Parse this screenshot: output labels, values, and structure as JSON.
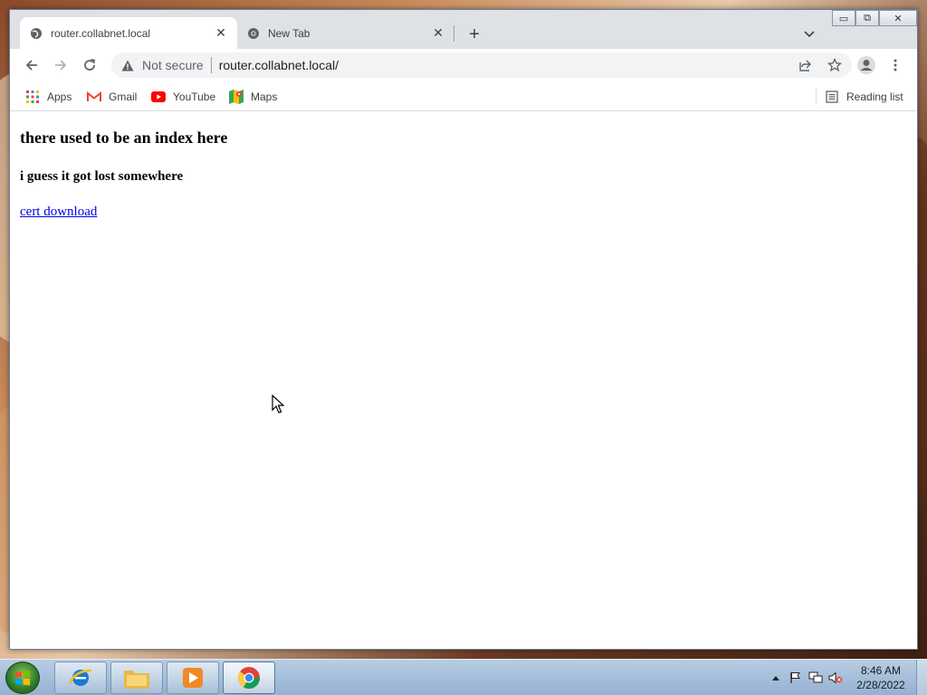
{
  "window": {
    "controls": {
      "minimize": "▭",
      "restore": "⧉",
      "close": "✕"
    }
  },
  "tabs": [
    {
      "title": "router.collabnet.local",
      "active": true,
      "close": "✕"
    },
    {
      "title": "New Tab",
      "active": false,
      "close": "✕"
    }
  ],
  "tabstrip": {
    "new_tab": "+"
  },
  "toolbar": {
    "security_label": "Not secure",
    "url": "router.collabnet.local/"
  },
  "bookmarks": {
    "items": [
      {
        "label": "Apps",
        "icon": "apps-grid-icon"
      },
      {
        "label": "Gmail",
        "icon": "gmail-icon"
      },
      {
        "label": "YouTube",
        "icon": "youtube-icon"
      },
      {
        "label": "Maps",
        "icon": "maps-icon"
      }
    ],
    "reading_list": "Reading list"
  },
  "page": {
    "heading": "there used to be an index here",
    "subheading": "i guess it got lost somewhere",
    "link": "cert download"
  },
  "taskbar": {
    "clock_time": "8:46 AM",
    "clock_date": "2/28/2022"
  },
  "colors": {
    "link": "#0000ee",
    "tab_bg": "#dee1e6",
    "omnibox_bg": "#f1f3f4",
    "youtube_red": "#ff0000",
    "gmail_red": "#ea4335"
  }
}
